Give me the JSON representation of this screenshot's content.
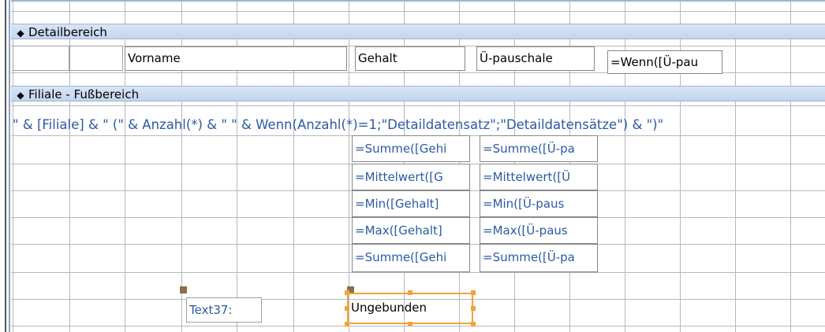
{
  "sections": {
    "detail": {
      "icon": "section-arrow-icon",
      "label": "Detailbereich"
    },
    "footer": {
      "icon": "section-arrow-icon",
      "label": "Filiale - Fußbereich"
    }
  },
  "detail_controls": {
    "vorname": "Vorname",
    "gehalt": "Gehalt",
    "pauschale": "Ü-pauschale",
    "wenn": "=Wenn([Ü-pau"
  },
  "footer_expression": "\" & [Filiale] & \" (\" & Anzahl(*) & \" \" & Wenn(Anzahl(*)=1;\"Detaildatensatz\";\"Detaildatensätze\") & \")\"",
  "aggregates": {
    "gehalt": [
      "=Summe([Gehi",
      "=Mittelwert([G",
      "=Min([Gehalt]",
      "=Max([Gehalt]",
      "=Summe([Gehi"
    ],
    "pauschale": [
      "=Summe([Ü-pa",
      "=Mittelwert([Ü",
      "=Min([Ü-paus",
      "=Max([Ü-paus",
      "=Summe([Ü-pa"
    ]
  },
  "bottom_controls": {
    "text37": "Text37:",
    "ungebunden": "Ungebunden"
  },
  "colors": {
    "section_bar": "#c3d5ee",
    "grid": "#b8b8b8",
    "selection": "#f2a33a",
    "handle": "#8d6e4a",
    "expression_text": "#2a5aa6"
  }
}
